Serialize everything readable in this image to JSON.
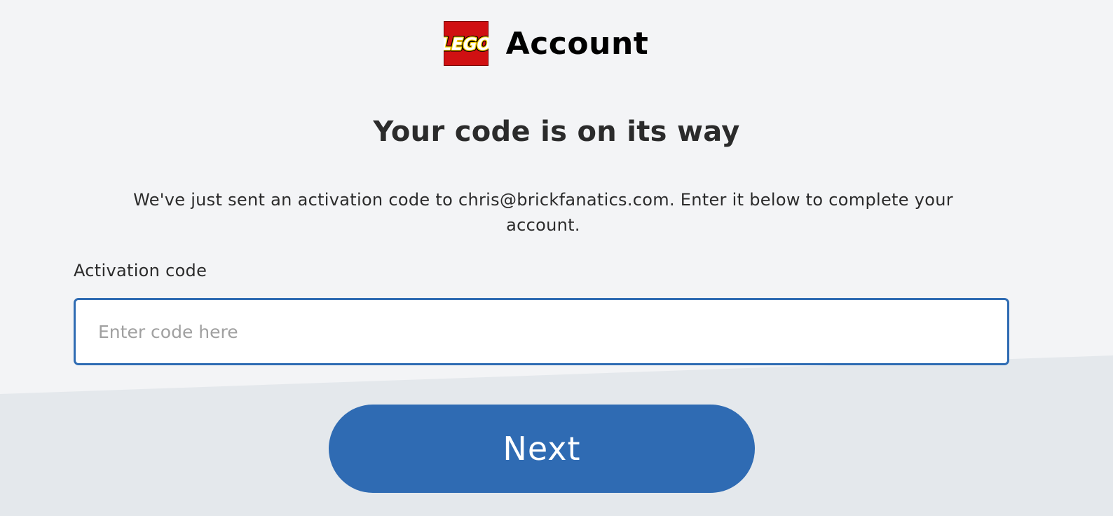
{
  "header": {
    "logo_text": "LEGO",
    "title": "Account"
  },
  "main": {
    "headline": "Your code is on its way",
    "message": "We've just sent an activation code to chris@brickfanatics.com. Enter it below to complete your account.",
    "field_label": "Activation code",
    "input": {
      "value": "",
      "placeholder": "Enter code here"
    },
    "next_label": "Next"
  },
  "colors": {
    "background": "#f3f4f6",
    "lower_band": "#e4e8ec",
    "accent": "#2f6bb3",
    "logo_red": "#d01012",
    "logo_yellow": "#ffcf00"
  }
}
